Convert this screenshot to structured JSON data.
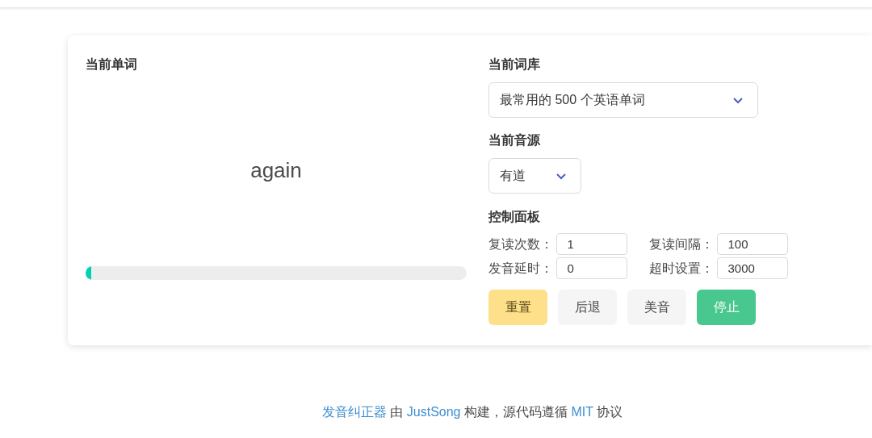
{
  "word_panel": {
    "heading": "当前单词",
    "word": "again",
    "progress": {
      "level": 0.015
    }
  },
  "settings": {
    "library": {
      "heading": "当前词库",
      "value": "最常用的 500 个英语单词"
    },
    "source": {
      "heading": "当前音源",
      "value": "有道"
    },
    "controls": {
      "heading": "控制面板",
      "fields": [
        {
          "label": "复读次数：",
          "value": "1"
        },
        {
          "label": "复读间隔：",
          "value": "100"
        },
        {
          "label": "发音延时：",
          "value": "0"
        },
        {
          "label": "超时设置：",
          "value": "3000"
        }
      ]
    },
    "buttons": [
      {
        "label": "重置",
        "kind": "warning"
      },
      {
        "label": "后退",
        "kind": "light"
      },
      {
        "label": "美音",
        "kind": "light"
      },
      {
        "label": "停止",
        "kind": "success"
      }
    ]
  },
  "footer": [
    {
      "kind": "link",
      "text": "发音纠正器"
    },
    {
      "kind": "text",
      "text": " 由 "
    },
    {
      "kind": "link",
      "text": "JustSong"
    },
    {
      "kind": "text",
      "text": " 构建，源代码遵循 "
    },
    {
      "kind": "link",
      "text": "MIT"
    },
    {
      "kind": "text",
      "text": " 协议"
    }
  ]
}
